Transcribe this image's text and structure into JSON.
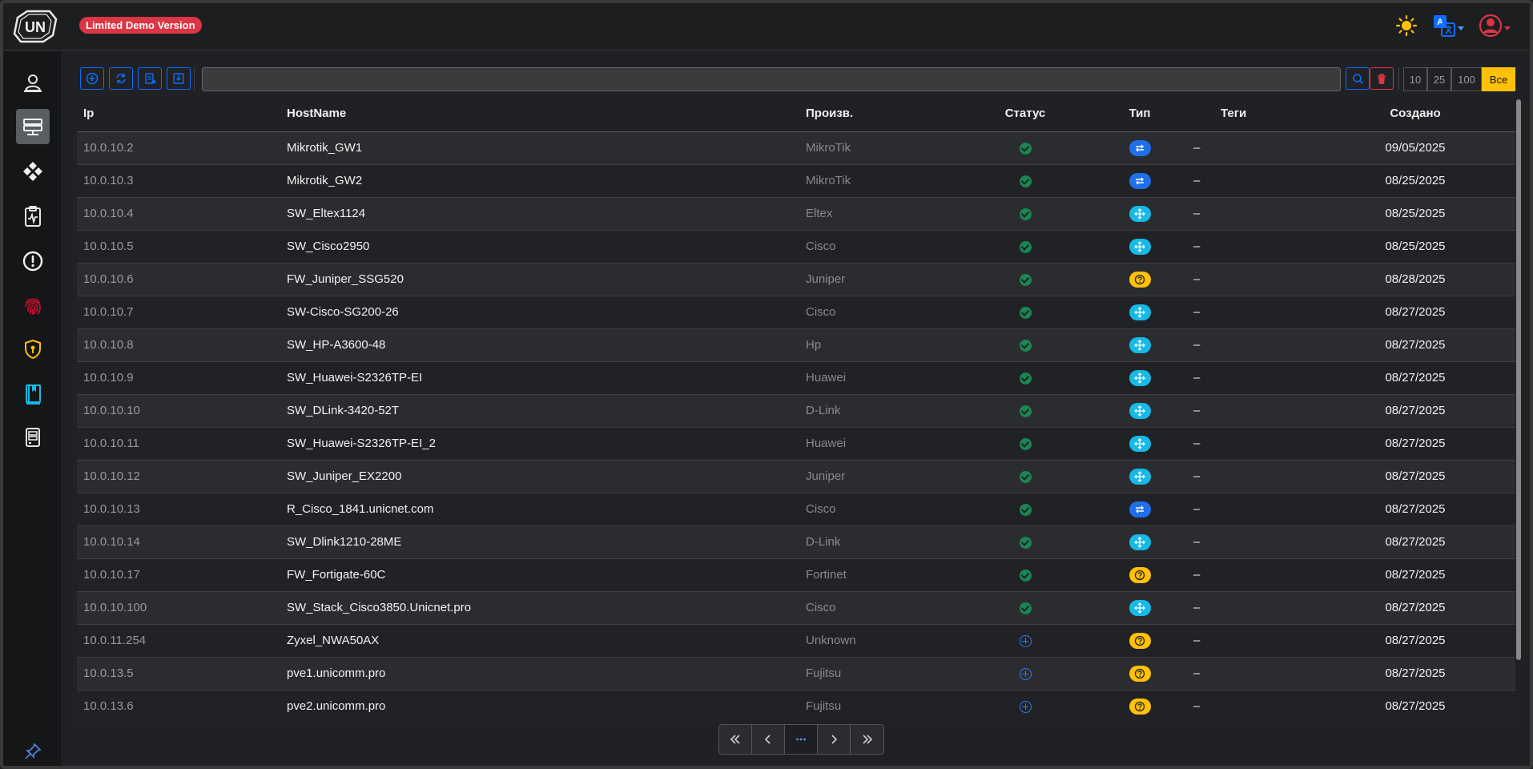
{
  "app": {
    "logo_text": "UN",
    "demo_badge": "Limited Demo Version"
  },
  "topbar": {
    "icons": [
      "theme-sun-icon",
      "translate-icon",
      "user-avatar-icon"
    ],
    "accent_colors": {
      "sun": "#ffc107",
      "translate": "#0d6efd",
      "user": "#dc3545"
    }
  },
  "sidebar": {
    "items": [
      {
        "name": "users",
        "icon": "user-icon",
        "active": false
      },
      {
        "name": "network-devices",
        "icon": "network-device-icon",
        "active": true
      },
      {
        "name": "modules",
        "icon": "diamonds-icon",
        "active": false
      },
      {
        "name": "monitoring",
        "icon": "clipboard-pulse-icon",
        "active": false
      },
      {
        "name": "alerts",
        "icon": "alert-icon",
        "active": false
      },
      {
        "name": "fingerprint",
        "icon": "fingerprint-icon",
        "active": false
      },
      {
        "name": "security",
        "icon": "shield-icon",
        "active": false
      },
      {
        "name": "docs",
        "icon": "book-icon",
        "active": false
      },
      {
        "name": "server",
        "icon": "server-icon",
        "active": false
      }
    ],
    "pin_icon": "pin-icon"
  },
  "toolbar": {
    "buttons": [
      "add-icon",
      "refresh-icon",
      "export-icon",
      "import-icon"
    ],
    "search_value": "",
    "page_sizes": [
      "10",
      "25",
      "100",
      "Все"
    ],
    "active_page_size": "Все"
  },
  "table": {
    "headers": {
      "ip": "Ip",
      "hostname": "HostName",
      "vendor": "Произв.",
      "status": "Статус",
      "type": "Тип",
      "tags": "Теги",
      "created": "Создано"
    },
    "rows": [
      {
        "ip": "10.0.10.2",
        "hostname": "Mikrotik_GW1",
        "vendor": "MikroTik",
        "status": "ok",
        "type": "router",
        "tags": "–",
        "created": "09/05/2025"
      },
      {
        "ip": "10.0.10.3",
        "hostname": "Mikrotik_GW2",
        "vendor": "MikroTik",
        "status": "ok",
        "type": "router",
        "tags": "–",
        "created": "08/25/2025"
      },
      {
        "ip": "10.0.10.4",
        "hostname": "SW_Eltex1124",
        "vendor": "Eltex",
        "status": "ok",
        "type": "switch",
        "tags": "–",
        "created": "08/25/2025"
      },
      {
        "ip": "10.0.10.5",
        "hostname": "SW_Cisco2950",
        "vendor": "Cisco",
        "status": "ok",
        "type": "switch",
        "tags": "–",
        "created": "08/25/2025"
      },
      {
        "ip": "10.0.10.6",
        "hostname": "FW_Juniper_SSG520",
        "vendor": "Juniper",
        "status": "ok",
        "type": "unknown",
        "tags": "–",
        "created": "08/28/2025"
      },
      {
        "ip": "10.0.10.7",
        "hostname": "SW-Cisco-SG200-26",
        "vendor": "Cisco",
        "status": "ok",
        "type": "switch",
        "tags": "–",
        "created": "08/27/2025"
      },
      {
        "ip": "10.0.10.8",
        "hostname": "SW_HP-A3600-48",
        "vendor": "Hp",
        "status": "ok",
        "type": "switch",
        "tags": "–",
        "created": "08/27/2025"
      },
      {
        "ip": "10.0.10.9",
        "hostname": "SW_Huawei-S2326TP-EI",
        "vendor": "Huawei",
        "status": "ok",
        "type": "switch",
        "tags": "–",
        "created": "08/27/2025"
      },
      {
        "ip": "10.0.10.10",
        "hostname": "SW_DLink-3420-52T",
        "vendor": "D-Link",
        "status": "ok",
        "type": "switch",
        "tags": "–",
        "created": "08/27/2025"
      },
      {
        "ip": "10.0.10.11",
        "hostname": "SW_Huawei-S2326TP-EI_2",
        "vendor": "Huawei",
        "status": "ok",
        "type": "switch",
        "tags": "–",
        "created": "08/27/2025"
      },
      {
        "ip": "10.0.10.12",
        "hostname": "SW_Juniper_EX2200",
        "vendor": "Juniper",
        "status": "ok",
        "type": "switch",
        "tags": "–",
        "created": "08/27/2025"
      },
      {
        "ip": "10.0.10.13",
        "hostname": "R_Cisco_1841.unicnet.com",
        "vendor": "Cisco",
        "status": "ok",
        "type": "router",
        "tags": "–",
        "created": "08/27/2025"
      },
      {
        "ip": "10.0.10.14",
        "hostname": "SW_Dlink1210-28ME",
        "vendor": "D-Link",
        "status": "ok",
        "type": "switch",
        "tags": "–",
        "created": "08/27/2025"
      },
      {
        "ip": "10.0.10.17",
        "hostname": "FW_Fortigate-60C",
        "vendor": "Fortinet",
        "status": "ok",
        "type": "unknown",
        "tags": "–",
        "created": "08/27/2025"
      },
      {
        "ip": "10.0.10.100",
        "hostname": "SW_Stack_Cisco3850.Unicnet.pro",
        "vendor": "Cisco",
        "status": "ok",
        "type": "switch",
        "tags": "–",
        "created": "08/27/2025"
      },
      {
        "ip": "10.0.11.254",
        "hostname": "Zyxel_NWA50AX",
        "vendor": "Unknown",
        "status": "add",
        "type": "unknown",
        "tags": "–",
        "created": "08/27/2025"
      },
      {
        "ip": "10.0.13.5",
        "hostname": "pve1.unicomm.pro",
        "vendor": "Fujitsu",
        "status": "add",
        "type": "unknown",
        "tags": "–",
        "created": "08/27/2025"
      },
      {
        "ip": "10.0.13.6",
        "hostname": "pve2.unicomm.pro",
        "vendor": "Fujitsu",
        "status": "add",
        "type": "unknown",
        "tags": "–",
        "created": "08/27/2025"
      }
    ]
  },
  "pagination": {
    "buttons": [
      "first-page-icon",
      "prev-page-icon",
      "more-pages-icon",
      "next-page-icon",
      "last-page-icon"
    ],
    "active": "more-pages-icon"
  },
  "colors": {
    "accent": "#0d6efd",
    "danger": "#dc3545",
    "warning": "#ffc107",
    "success": "#198754",
    "switch_type": "#17b9e6"
  }
}
